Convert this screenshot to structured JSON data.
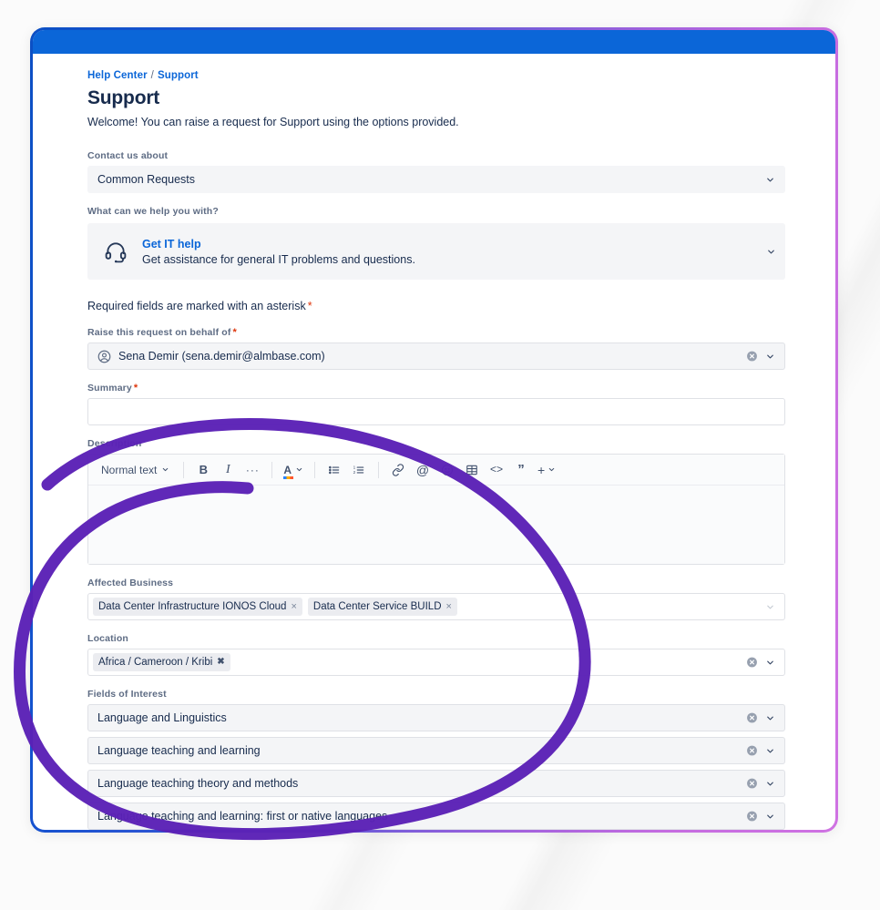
{
  "window": {
    "title_bar_color": "#0b66d8",
    "border_gradient_start": "#0b4fc4",
    "border_gradient_end": "#cf72e2"
  },
  "breadcrumb": {
    "items": [
      "Help Center",
      "Support"
    ],
    "separator": "/"
  },
  "page": {
    "title": "Support",
    "welcome": "Welcome! You can raise a request for Support using the options provided."
  },
  "contact_about": {
    "label": "Contact us about",
    "value": "Common Requests",
    "chevron_icon": "chevron-down-icon"
  },
  "help_with": {
    "label": "What can we help you with?",
    "card": {
      "icon": "headset-icon",
      "title": "Get IT help",
      "description": "Get assistance for general IT problems and questions.",
      "chevron_icon": "chevron-down-icon"
    }
  },
  "required_note": {
    "text": "Required fields are marked with an asterisk",
    "marker": "*"
  },
  "on_behalf_of": {
    "label": "Raise this request on behalf of",
    "required": true,
    "avatar_icon": "avatar-icon",
    "value": "Sena Demir (sena.demir@almbase.com)",
    "clear_icon": "clear-circle-icon",
    "chevron_icon": "chevron-down-icon"
  },
  "summary": {
    "label": "Summary",
    "required": true,
    "value": "",
    "placeholder": ""
  },
  "description": {
    "label": "Description",
    "value": "",
    "toolbar": {
      "text_style": "Normal text",
      "buttons": [
        {
          "name": "bold-button",
          "glyph": "B"
        },
        {
          "name": "italic-button",
          "glyph": "I"
        },
        {
          "name": "more-formatting-button",
          "glyph": "···"
        },
        {
          "name": "text-color-button",
          "glyph": "A"
        },
        {
          "name": "bullet-list-button",
          "glyph": "list"
        },
        {
          "name": "numbered-list-button",
          "glyph": "numlist"
        },
        {
          "name": "link-button",
          "glyph": "🔗"
        },
        {
          "name": "mention-button",
          "glyph": "@"
        },
        {
          "name": "emoji-button",
          "glyph": "☺"
        },
        {
          "name": "table-button",
          "glyph": "table"
        },
        {
          "name": "code-button",
          "glyph": "<>"
        },
        {
          "name": "quote-button",
          "glyph": "”"
        },
        {
          "name": "insert-more-button",
          "glyph": "+"
        }
      ]
    }
  },
  "affected_business": {
    "label": "Affected Business",
    "tokens": [
      "Data Center Infrastructure IONOS Cloud",
      "Data Center Service BUILD"
    ],
    "token_remove_glyph": "×",
    "chevron_icon": "chevron-down-icon"
  },
  "location": {
    "label": "Location",
    "tokens": [
      "Africa / Cameroon / Kribi"
    ],
    "token_remove_glyph": "✖",
    "clear_icon": "clear-circle-icon",
    "chevron_icon": "chevron-down-icon"
  },
  "fields_of_interest": {
    "label": "Fields of Interest",
    "rows": [
      "Language and Linguistics",
      "Language teaching and learning",
      "Language teaching theory and methods",
      "Language teaching and learning: first or native languages"
    ],
    "clear_icon": "clear-circle-icon",
    "chevron_icon": "chevron-down-icon"
  },
  "annotation": {
    "shape": "hand-drawn-ellipse",
    "color": "#5b21b6"
  }
}
